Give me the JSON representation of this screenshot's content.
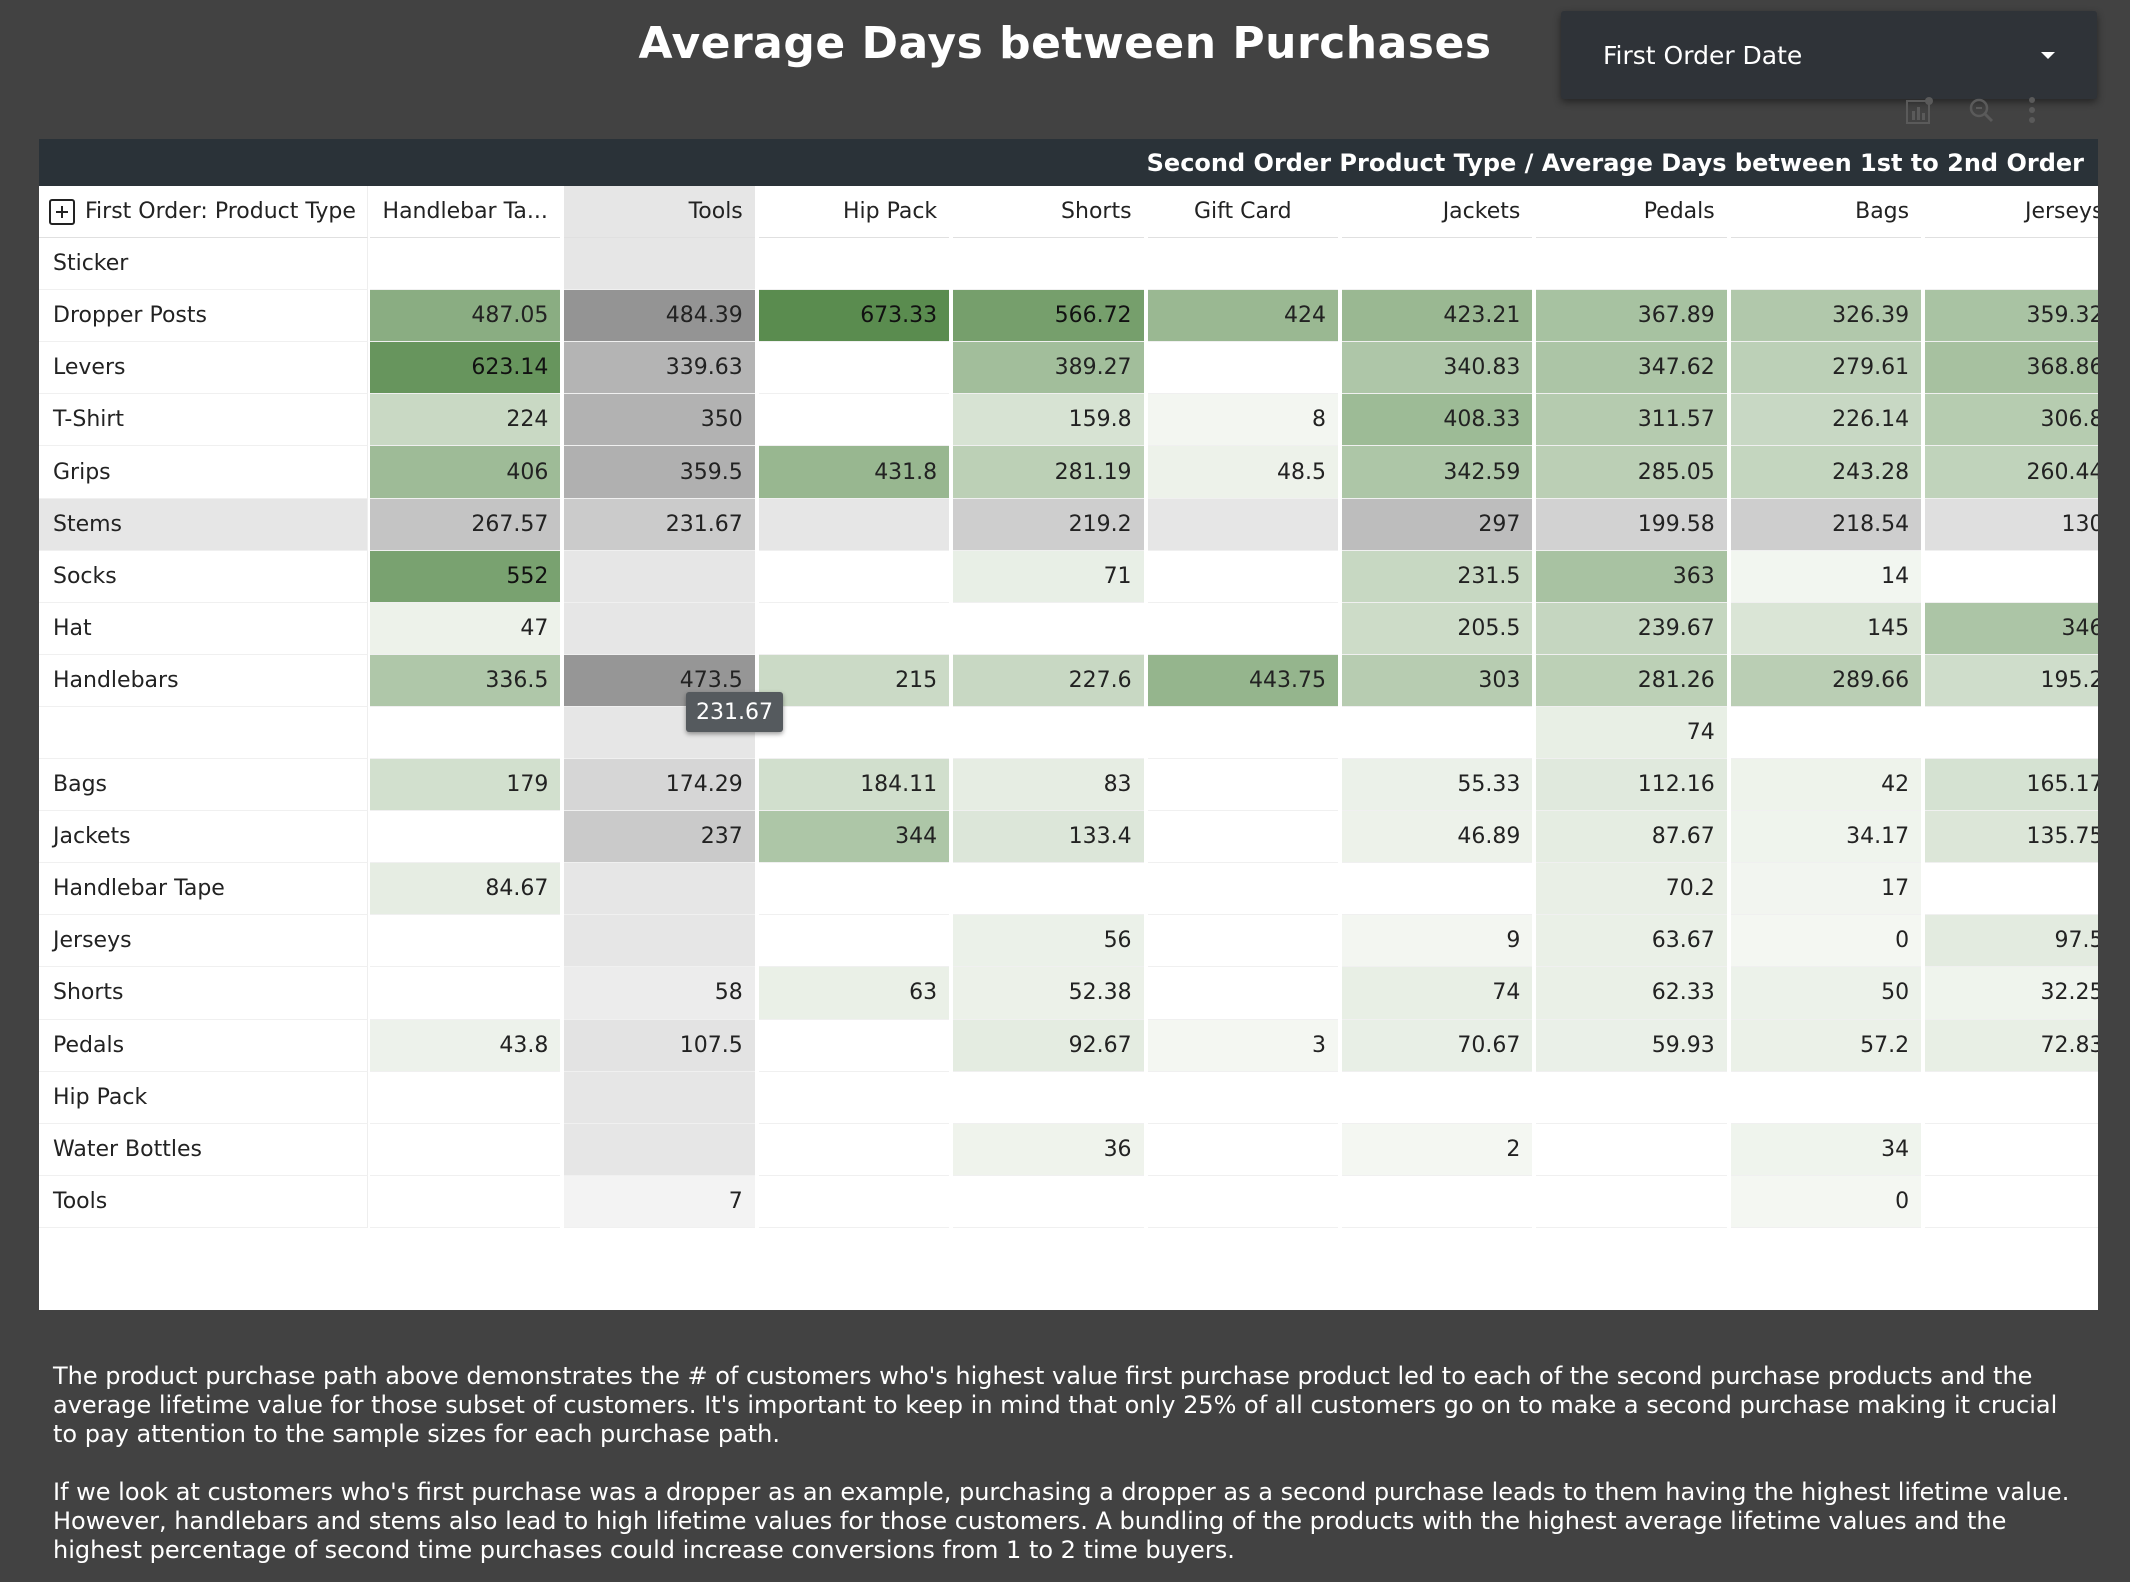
{
  "title": "Average Days between Purchases",
  "filter": {
    "selected": "First Order Date"
  },
  "toolbar": {
    "icons": [
      "chart-settings-icon",
      "search-zoom-icon",
      "more-vertical-icon"
    ]
  },
  "table": {
    "column_header_title": "Second Order Product Type / Average Days between 1st to 2nd Order",
    "row_header_title": "First Order: Product Type",
    "columns": [
      "Handlebar Ta...",
      "Tools",
      "Hip Pack",
      "Shorts",
      "Gift Card",
      "Jackets",
      "Pedals",
      "Bags",
      "Jerseys"
    ],
    "rows": [
      {
        "label": "Sticker",
        "values": [
          null,
          null,
          null,
          null,
          null,
          null,
          null,
          null,
          null
        ]
      },
      {
        "label": "Dropper Posts",
        "values": [
          "487.05",
          "484.39",
          "673.33",
          "566.72",
          "424",
          "423.21",
          "367.89",
          "326.39",
          "359.32"
        ]
      },
      {
        "label": "Levers",
        "values": [
          "623.14",
          "339.63",
          null,
          "389.27",
          null,
          "340.83",
          "347.62",
          "279.61",
          "368.86"
        ]
      },
      {
        "label": "T-Shirt",
        "values": [
          "224",
          "350",
          null,
          "159.8",
          "8",
          "408.33",
          "311.57",
          "226.14",
          "306.8"
        ]
      },
      {
        "label": "Grips",
        "values": [
          "406",
          "359.5",
          "431.8",
          "281.19",
          "48.5",
          "342.59",
          "285.05",
          "243.28",
          "260.44"
        ]
      },
      {
        "label": "Stems",
        "values": [
          "267.57",
          "231.67",
          null,
          "219.2",
          null,
          "297",
          "199.58",
          "218.54",
          "130"
        ]
      },
      {
        "label": "Socks",
        "values": [
          "552",
          null,
          null,
          "71",
          null,
          "231.5",
          "363",
          "14",
          null
        ]
      },
      {
        "label": "Hat",
        "values": [
          "47",
          null,
          null,
          null,
          null,
          "205.5",
          "239.67",
          "145",
          "346"
        ]
      },
      {
        "label": "Handlebars",
        "values": [
          "336.5",
          "473.5",
          "215",
          "227.6",
          "443.75",
          "303",
          "281.26",
          "289.66",
          "195.2"
        ]
      },
      {
        "label": "",
        "values": [
          null,
          null,
          null,
          null,
          null,
          null,
          "74",
          null,
          null
        ]
      },
      {
        "label": "Bags",
        "values": [
          "179",
          "174.29",
          "184.11",
          "83",
          null,
          "55.33",
          "112.16",
          "42",
          "165.17"
        ]
      },
      {
        "label": "Jackets",
        "values": [
          null,
          "237",
          "344",
          "133.4",
          null,
          "46.89",
          "87.67",
          "34.17",
          "135.75"
        ]
      },
      {
        "label": "Handlebar Tape",
        "values": [
          "84.67",
          null,
          null,
          null,
          null,
          null,
          "70.2",
          "17",
          null
        ]
      },
      {
        "label": "Jerseys",
        "values": [
          null,
          null,
          null,
          "56",
          null,
          "9",
          "63.67",
          "0",
          "97.5"
        ]
      },
      {
        "label": "Shorts",
        "values": [
          null,
          "58",
          "63",
          "52.38",
          null,
          "74",
          "62.33",
          "50",
          "32.25"
        ]
      },
      {
        "label": "Pedals",
        "values": [
          "43.8",
          "107.5",
          null,
          "92.67",
          "3",
          "70.67",
          "59.93",
          "57.2",
          "72.83"
        ]
      },
      {
        "label": "Hip Pack",
        "values": [
          null,
          null,
          null,
          null,
          null,
          null,
          null,
          null,
          null
        ]
      },
      {
        "label": "Water Bottles",
        "values": [
          null,
          null,
          null,
          "36",
          null,
          "2",
          null,
          "34",
          null
        ]
      },
      {
        "label": "Tools",
        "values": [
          null,
          "7",
          null,
          null,
          null,
          null,
          null,
          "0",
          null
        ]
      }
    ],
    "hovered": {
      "row": "Stems",
      "column": "Tools",
      "tooltip": "231.67"
    },
    "colors": {
      "heat_low": "#f4f7f2",
      "heat_high": "#5a8c4f",
      "highlight_gray": "#e6e6e6"
    }
  },
  "narrative": [
    "The product purchase path above demonstrates the # of customers who's highest value first purchase product led to each of the second purchase products and the average lifetime value for those subset of customers. It's important to keep in mind that  only 25% of all customers go on to make a second purchase making it crucial to pay attention to the sample sizes for each purchase path.",
    "If we look at customers who's first purchase was a dropper as an example, purchasing a dropper as a second purchase leads to them having the highest lifetime value. However, handlebars and stems also lead to high lifetime values for those customers. A bundling of the products with the highest average lifetime values and the highest percentage of second time purchases could increase conversions from 1 to 2 time buyers."
  ]
}
